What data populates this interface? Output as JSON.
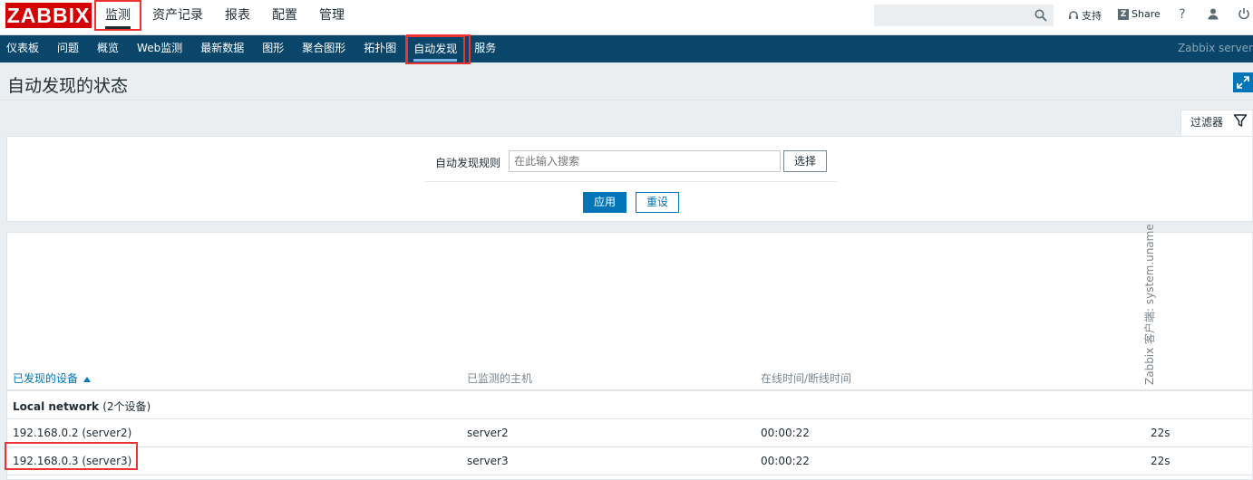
{
  "header": {
    "logo": "ZABBIX",
    "menu": [
      "监测",
      "资产记录",
      "报表",
      "配置",
      "管理"
    ],
    "support_label": "支持",
    "share_label": "Share",
    "help_label": "?"
  },
  "subnav": {
    "items": [
      "仪表板",
      "问题",
      "概览",
      "Web监测",
      "最新数据",
      "图形",
      "聚合图形",
      "拓扑图",
      "自动发现",
      "服务"
    ],
    "active": "自动发现",
    "server_name": "Zabbix server"
  },
  "page": {
    "title": "自动发现的状态"
  },
  "filter": {
    "tab_label": "过滤器",
    "rule_label": "自动发现规则",
    "input_placeholder": "在此输入搜索",
    "select_label": "选择",
    "apply_label": "应用",
    "reset_label": "重设"
  },
  "table": {
    "columns": {
      "device": "已发现的设备",
      "host": "已监测的主机",
      "uptime": "在线时间/断线时间",
      "check": "Zabbix 客户端: system.uname"
    },
    "group": {
      "name": "Local network",
      "count": "(2个设备)"
    },
    "rows": [
      {
        "device": "192.168.0.2 (server2)",
        "host": "server2",
        "uptime": "00:00:22",
        "check": "22s"
      },
      {
        "device": "192.168.0.3 (server3)",
        "host": "server3",
        "uptime": "00:00:22",
        "check": "22s"
      }
    ]
  },
  "colors": {
    "brand": "#d40000",
    "nav": "#0a466a",
    "accent": "#0275b8",
    "highlight": "#ee3333"
  }
}
